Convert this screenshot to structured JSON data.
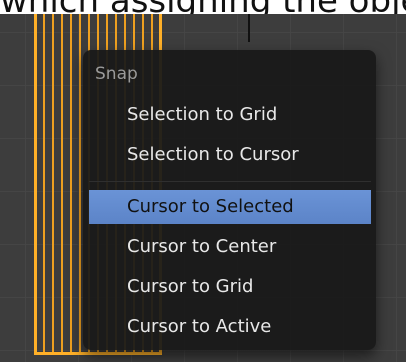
{
  "caption": {
    "text": "which assigning the object or"
  },
  "menu": {
    "title": "Snap",
    "items": [
      {
        "label": "Selection to Grid"
      },
      {
        "label": "Selection to Cursor"
      },
      {
        "label": "Cursor to Selected"
      },
      {
        "label": "Cursor to Center"
      },
      {
        "label": "Cursor to Grid"
      },
      {
        "label": "Cursor to Active"
      }
    ],
    "highlighted_item": "Cursor to Selected"
  },
  "colors": {
    "highlight": "#5c84c8",
    "wireframe": "#f7a51e",
    "menu_background": "#1a1a1a"
  }
}
